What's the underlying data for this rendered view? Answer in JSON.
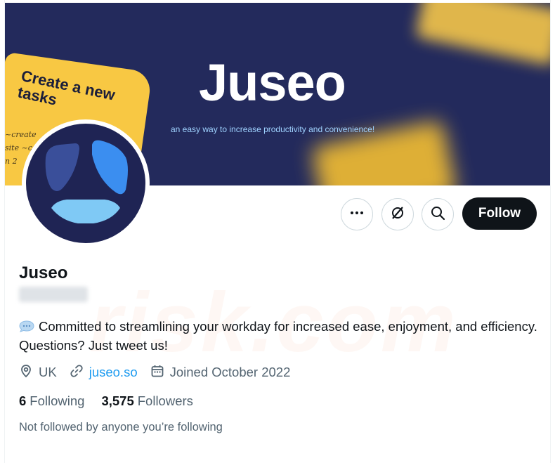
{
  "banner": {
    "brand_title": "Juseo",
    "tagline": "an easy way to increase productivity and convenience!",
    "sticky_note_text": "Create a new tasks",
    "scribble_text": "~create site ~con n 2",
    "colors": {
      "background": "#232a5c",
      "sticky": "#f8c843",
      "tagline": "#9fd2ff"
    }
  },
  "avatar": {
    "icon": "juseo-logo-icon",
    "colors": {
      "background": "#1f2454",
      "petal_dark": "#3a4f9a",
      "petal_blue": "#3b8ef0",
      "petal_light": "#7fc9f5"
    }
  },
  "actions": {
    "more_icon": "more-options-icon",
    "grok_icon": "grok-icon",
    "search_icon": "search-icon",
    "follow_label": "Follow"
  },
  "profile": {
    "display_name": "Juseo",
    "bio": "Committed to streamlining your workday for increased ease, enjoyment, and efficiency. Questions? Just tweet us!",
    "bio_emoji_icon": "speech-bubble-icon",
    "location": "UK",
    "website": "juseo.so",
    "joined": "Joined October 2022"
  },
  "stats": {
    "following_count": "6",
    "following_label": "Following",
    "followers_count": "3,575",
    "followers_label": "Followers"
  },
  "social_context": "Not followed by anyone you’re following",
  "watermark": "risk.com"
}
